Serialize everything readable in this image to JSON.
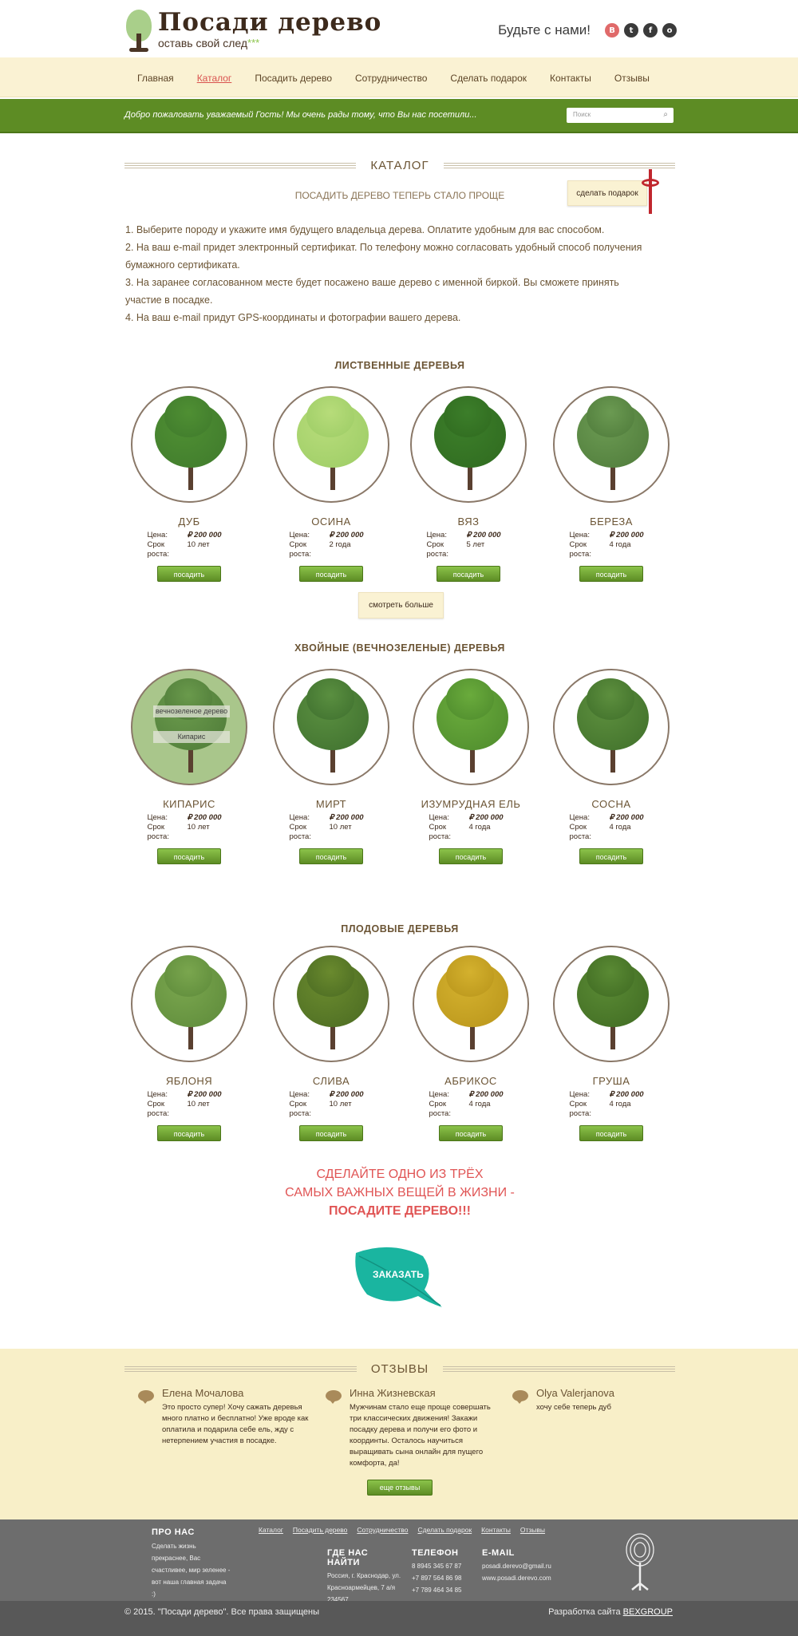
{
  "header": {
    "logo_title": "Посади дерево",
    "logo_sub": "оставь свой след",
    "logo_stars": "***",
    "social_label": "Будьте с нами!",
    "social": [
      "B",
      "t",
      "f",
      "o"
    ]
  },
  "nav": {
    "items": [
      "Главная",
      "Каталог",
      "Посадить дерево",
      "Сотрудничество",
      "Сделать подарок",
      "Контакты",
      "Отзывы"
    ],
    "active": 1
  },
  "greenbar": {
    "greeting": "Добро пожаловать уважаемый Гость!  Мы очень рады тому, что Вы нас посетили...",
    "search_placeholder": "Поиск"
  },
  "catalog": {
    "title": "КАТАЛОГ",
    "subtitle": "ПОСАДИТЬ ДЕРЕВО ТЕПЕРЬ СТАЛО ПРОЩЕ",
    "gift_button": "сделать подарок",
    "steps": [
      "1. Выберите породу и укажите имя будущего владельца дерева. Оплатите удобным для вас способом.",
      "2. На ваш e-mail придет электронный сертификат.  По телефону можно согласовать удобный способ получения бумажного сертификата.",
      "3. На заранее согласованном месте будет посажено ваше дерево с именной биркой. Вы сможете принять участие в посадке.",
      "4. На ваш e-mail придут GPS-координаты и фотографии вашего дерева."
    ]
  },
  "labels": {
    "price": "Цена:",
    "growth": "Срок роста:",
    "plant_button": "посадить",
    "more_button": "смотреть больше"
  },
  "sections": [
    {
      "title": "ЛИСТВЕННЫЕ ДЕРЕВЬЯ",
      "trees": [
        {
          "name": "ДУБ",
          "price": "₽ 200 000",
          "growth": "10 лет"
        },
        {
          "name": "ОСИНА",
          "price": "₽ 200 000",
          "growth": "2 года"
        },
        {
          "name": "ВЯЗ",
          "price": "₽ 200 000",
          "growth": "5 лет"
        },
        {
          "name": "БЕРЕЗА",
          "price": "₽ 200 000",
          "growth": "4 года"
        }
      ]
    },
    {
      "title": "ХВОЙНЫЕ (ВЕЧНОЗЕЛЕНЫЕ) ДЕРЕВЬЯ",
      "overlay": [
        "вечнозеленое дерево",
        "Кипарис"
      ],
      "trees": [
        {
          "name": "КИПАРИС",
          "price": "₽ 200 000",
          "growth": "10 лет"
        },
        {
          "name": "МИРТ",
          "price": "₽ 200 000",
          "growth": "10 лет"
        },
        {
          "name": "ИЗУМРУДНАЯ ЕЛЬ",
          "price": "₽ 200 000",
          "growth": "4 года"
        },
        {
          "name": "СОСНА",
          "price": "₽ 200 000",
          "growth": "4 года"
        }
      ]
    },
    {
      "title": "ПЛОДОВЫЕ ДЕРЕВЬЯ",
      "trees": [
        {
          "name": "ЯБЛОНЯ",
          "price": "₽ 200 000",
          "growth": "10 лет"
        },
        {
          "name": "СЛИВА",
          "price": "₽ 200 000",
          "growth": "10 лет"
        },
        {
          "name": "АБРИКОС",
          "price": "₽ 200 000",
          "growth": "4 года"
        },
        {
          "name": "ГРУША",
          "price": "₽ 200 000",
          "growth": "4 года"
        }
      ]
    }
  ],
  "slogan": {
    "line1": "СДЕЛАЙТЕ ОДНО ИЗ ТРЁХ",
    "line2": "САМЫХ ВАЖНЫХ ВЕЩЕЙ В ЖИЗНИ -",
    "line3": "ПОСАДИТЕ ДЕРЕВО!!!",
    "order_button": "ЗАКАЗАТЬ"
  },
  "reviews": {
    "title": "ОТЗЫВЫ",
    "items": [
      {
        "name": "Елена Мочалова",
        "text": "Это просто супер! Хочу сажать деревья много платно и бесплатно! Уже вроде как оплатила и подарила себе ель, жду с нетерпением участия в посадке."
      },
      {
        "name": "Инна Жизневская",
        "text": "Мужчинам стало еще проще совершать три классических движения! Закажи посадку дерева и получи его фото и координты. Осталось научиться выращивать сына онлайн для пущего комфорта, да!"
      },
      {
        "name": "Olya Valerjanova",
        "text": "хочу себе теперь дуб"
      }
    ],
    "all_button": "еще отзывы"
  },
  "footer": {
    "about_title": "ПРО НАС",
    "about_text": "Сделать жизнь прекраснее, Вас счастливее, мир зеленее - вот наша главная задача :)",
    "links": [
      "Каталог",
      "Посадить дерево",
      "Сотрудничество",
      "Сделать подарок",
      "Контакты",
      "Отзывы"
    ],
    "where_title": "ГДЕ НАС НАЙТИ",
    "where_text": "Россия, г. Краснодар, ул. Красноармейцев, 7 а/я 234567",
    "phone_title": "ТЕЛЕФОН",
    "phones": [
      "8 8945 345 67 87",
      "+7 897 564 86 98",
      "+7 789 464 34 85"
    ],
    "email_title": "E-MAIL",
    "emails": [
      "posadi.derevo@gmail.ru",
      "www.posadi.derevo.com"
    ],
    "copyright": "© 2015. \"Посади дерево\". Все права защищены",
    "dev_label": "Разработка сайта",
    "dev_name": "BEXGROUP"
  }
}
